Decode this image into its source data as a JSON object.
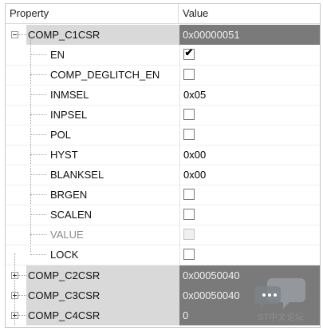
{
  "header": {
    "property": "Property",
    "value": "Value"
  },
  "root": {
    "name": "COMP_C1CSR",
    "value": "0x00000051",
    "children": [
      {
        "name": "EN",
        "type": "checkbox",
        "checked": true,
        "disabled": false
      },
      {
        "name": "COMP_DEGLITCH_EN",
        "type": "checkbox",
        "checked": false,
        "disabled": false
      },
      {
        "name": "INMSEL",
        "type": "text",
        "value": "0x05",
        "disabled": false
      },
      {
        "name": "INPSEL",
        "type": "checkbox",
        "checked": false,
        "disabled": false
      },
      {
        "name": "POL",
        "type": "checkbox",
        "checked": false,
        "disabled": false
      },
      {
        "name": "HYST",
        "type": "text",
        "value": "0x00",
        "disabled": false
      },
      {
        "name": "BLANKSEL",
        "type": "text",
        "value": "0x00",
        "disabled": false
      },
      {
        "name": "BRGEN",
        "type": "checkbox",
        "checked": false,
        "disabled": false
      },
      {
        "name": "SCALEN",
        "type": "checkbox",
        "checked": false,
        "disabled": false
      },
      {
        "name": "VALUE",
        "type": "checkbox",
        "checked": false,
        "disabled": true
      },
      {
        "name": "LOCK",
        "type": "checkbox",
        "checked": false,
        "disabled": false
      }
    ]
  },
  "collapsed": [
    {
      "name": "COMP_C2CSR",
      "value": "0x00050040"
    },
    {
      "name": "COMP_C3CSR",
      "value": "0x00050040"
    },
    {
      "name": "COMP_C4CSR",
      "value": "0"
    }
  ],
  "watermark": {
    "text": "ST中文论坛"
  },
  "checkmark_glyph": "✔",
  "colors": {
    "group_band": "#d9d9d9",
    "group_value": "#7a7a7a"
  }
}
